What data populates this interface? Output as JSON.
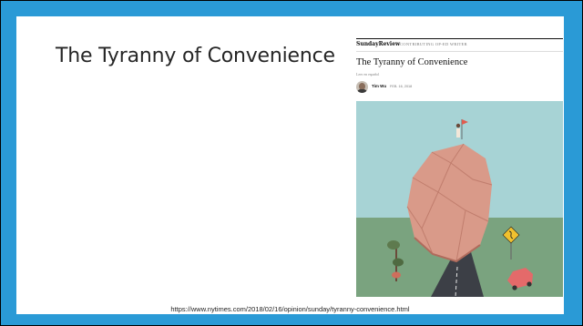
{
  "slide": {
    "title": "The Tyranny of Convenience",
    "source_url": "https://www.nytimes.com/2018/02/16/opinion/sunday/tyranny-convenience.html"
  },
  "article": {
    "brand": "SundayReview",
    "section": "CONTRIBUTING OP-ED WRITER",
    "headline": "The Tyranny of Convenience",
    "language_link": "Leer en español",
    "author": "Tim Wu",
    "date": "FEB. 16, 2018"
  },
  "colors": {
    "frame": "#2a9ad6",
    "sky": "#a7d3d5",
    "ground": "#7aa37f",
    "boulder": "#d99a89",
    "road": "#3c3f46",
    "car": "#e46a6a"
  }
}
